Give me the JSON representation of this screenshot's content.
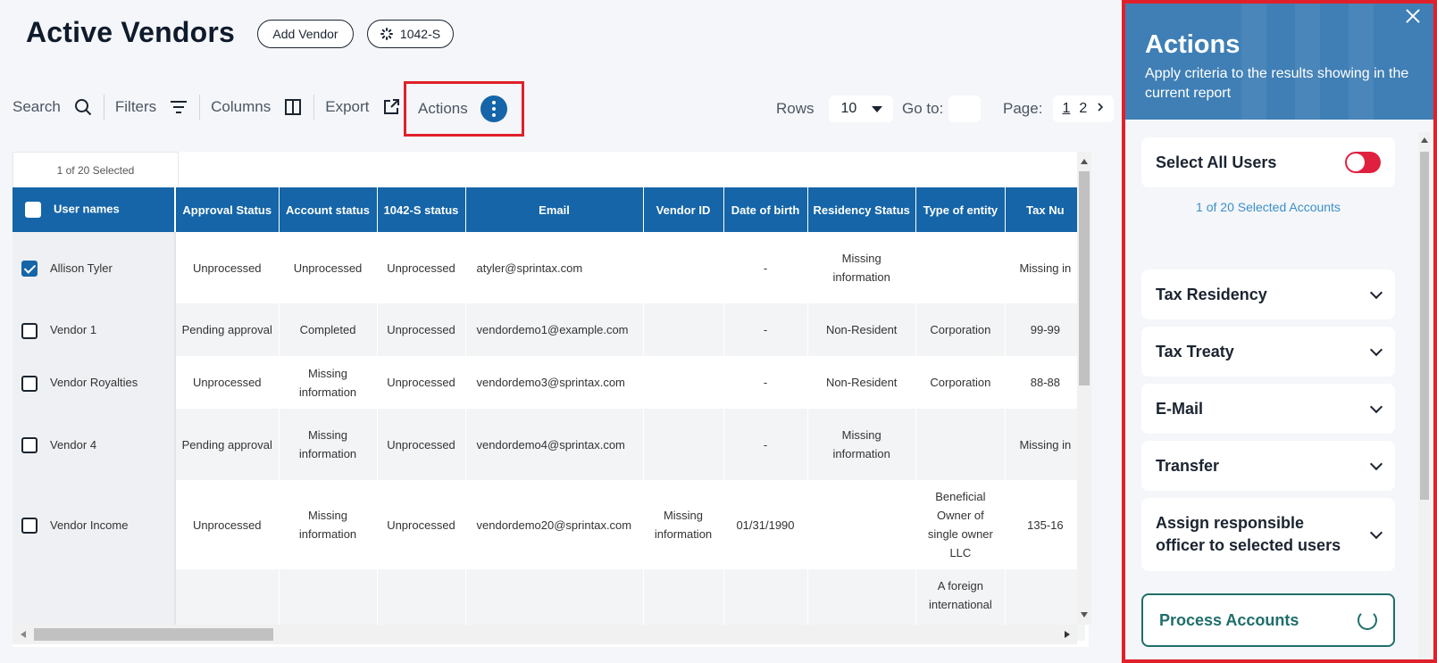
{
  "header": {
    "title": "Active Vendors",
    "add_vendor": "Add Vendor",
    "form_pill": "1042-S"
  },
  "toolbar": {
    "search": "Search",
    "filters": "Filters",
    "columns": "Columns",
    "export": "Export",
    "actions": "Actions",
    "rows_label": "Rows",
    "rows_value": "10",
    "goto_label": "Go to:",
    "page_label": "Page:",
    "pages": [
      "1",
      "2"
    ]
  },
  "table": {
    "selected_count": "1 of 20 Selected",
    "columns": [
      "User names",
      "Approval Status",
      "Account status",
      "1042-S status",
      "Email",
      "Vendor ID",
      "Date of birth",
      "Residency Status",
      "Type of entity",
      "Tax Nu"
    ],
    "rows": [
      {
        "name": "Allison Tyler",
        "checked": true,
        "approval": "Unprocessed",
        "account": "Unprocessed",
        "form": "Unprocessed",
        "email": "atyler@sprintax.com",
        "vendor_id": "",
        "dob": "-",
        "residency": "Missing information",
        "entity": "",
        "tax": "Missing in"
      },
      {
        "name": "Vendor 1",
        "checked": false,
        "approval": "Pending approval",
        "account": "Completed",
        "form": "Unprocessed",
        "email": "vendordemo1@example.com",
        "vendor_id": "",
        "dob": "-",
        "residency": "Non-Resident",
        "entity": "Corporation",
        "tax": "99-99"
      },
      {
        "name": "Vendor Royalties",
        "checked": false,
        "approval": "Unprocessed",
        "account": "Missing information",
        "form": "Unprocessed",
        "email": "vendordemo3@sprintax.com",
        "vendor_id": "",
        "dob": "-",
        "residency": "Non-Resident",
        "entity": "Corporation",
        "tax": "88-88"
      },
      {
        "name": "Vendor 4",
        "checked": false,
        "approval": "Pending approval",
        "account": "Missing information",
        "form": "Unprocessed",
        "email": "vendordemo4@sprintax.com",
        "vendor_id": "",
        "dob": "-",
        "residency": "Missing information",
        "entity": "",
        "tax": "Missing in"
      },
      {
        "name": "Vendor Income",
        "checked": false,
        "approval": "Unprocessed",
        "account": "Missing information",
        "form": "Unprocessed",
        "email": "vendordemo20@sprintax.com",
        "vendor_id": "Missing information",
        "dob": "01/31/1990",
        "residency": "",
        "entity": "Beneficial Owner of single owner LLC",
        "tax": "135-16"
      },
      {
        "name": "",
        "checked": null,
        "approval": "",
        "account": "",
        "form": "",
        "email": "",
        "vendor_id": "",
        "dob": "",
        "residency": "",
        "entity": "A foreign international",
        "tax": ""
      }
    ]
  },
  "panel": {
    "title": "Actions",
    "subtitle": "Apply criteria to the results showing in the current report",
    "select_all": "Select All Users",
    "select_all_on": false,
    "selected_accounts": "1 of 20 Selected Accounts",
    "sections": [
      "Tax Residency",
      "Tax Treaty",
      "E-Mail",
      "Transfer",
      "Assign responsible officer to selected users"
    ],
    "process_button": "Process Accounts"
  },
  "colors": {
    "header_blue": "#1565a8",
    "panel_blue": "#3f7fb5",
    "highlight_red": "#e0202a",
    "toggle_red": "#e0203f",
    "process_teal": "#1f6e6a"
  }
}
